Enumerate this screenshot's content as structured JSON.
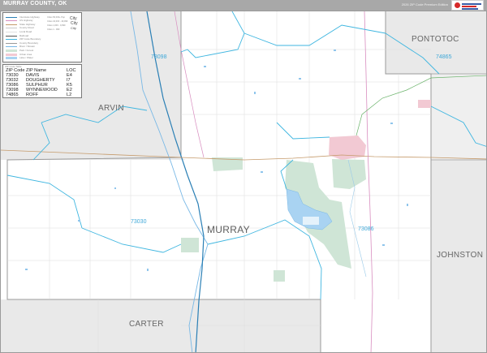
{
  "title": "MURRAY COUNTY, OK",
  "edition": "2026 ZIP Code Premium Edition",
  "colors": {
    "neighbor_county": "#e9e9e9",
    "county_line": "#9a9a9a",
    "zip_line": "#3fb6e0",
    "interstate": "#2a7fb5",
    "highway": "#c59a6a",
    "us_route": "#d88dbf",
    "park": "#cfe5d6",
    "urban": "#f2c9d3",
    "water": "#78b8e6",
    "road": "#d6d6d6"
  },
  "legend": {
    "items": [
      {
        "label": "Interstate Highway",
        "color": "#2a7fb5",
        "icon": "interstate-line"
      },
      {
        "label": "US Highway",
        "color": "#d88dbf",
        "icon": "us-highway-line"
      },
      {
        "label": "State Highway",
        "color": "#c59a6a",
        "icon": "state-highway-line"
      },
      {
        "label": "County Road",
        "color": "#c8c8c8",
        "icon": "county-road-line"
      },
      {
        "label": "Local Road",
        "color": "#e0e0e0",
        "icon": "local-road-line"
      },
      {
        "label": "Railroad",
        "color": "#555555",
        "icon": "railroad-line"
      },
      {
        "label": "ZIP Code Boundary",
        "color": "#3fb6e0",
        "icon": "zip-boundary-line"
      },
      {
        "label": "County Boundary",
        "color": "#9a9a9a",
        "icon": "county-boundary-line"
      },
      {
        "label": "River / Stream",
        "color": "#78b8e6",
        "icon": "river-line"
      },
      {
        "label": "Park / Forest",
        "color": "#cfe5d6",
        "icon": "park-swatch"
      },
      {
        "label": "Urban Area",
        "color": "#f2c9d3",
        "icon": "urban-swatch"
      },
      {
        "label": "Lake / Water",
        "color": "#a9d3f2",
        "icon": "water-swatch"
      }
    ],
    "city_key": [
      {
        "label": "City",
        "icon": "city-large"
      },
      {
        "label": "City",
        "icon": "city-medium"
      },
      {
        "label": "City",
        "icon": "city-small"
      }
    ],
    "population_rows": [
      "Cities 50,000+ Pop",
      "Cities 10,000 - 49,999",
      "Cities 1,000 - 9,999",
      "Cities 1 - 999"
    ]
  },
  "zip_table": {
    "title": "ZIP Code Table",
    "headers": [
      "ZIP Code",
      "ZIP Name",
      "LOC"
    ],
    "rows": [
      [
        "73030",
        "DAVIS",
        "E4"
      ],
      [
        "73032",
        "DOUGHERTY",
        "I7"
      ],
      [
        "73086",
        "SULPHUR",
        "K5"
      ],
      [
        "73098",
        "WYNNEWOOD",
        "E2"
      ],
      [
        "74865",
        "ROFF",
        "L2"
      ]
    ]
  },
  "labels": {
    "counties": {
      "pontotoc": "PONTOTOC",
      "garvin": "ARVIN",
      "murray": "MURRAY",
      "johnston": "JOHNSTON",
      "carter": "CARTER"
    },
    "zips": {
      "z73098": "73098",
      "z74865": "74865",
      "z73030": "73030",
      "z73086": "73086"
    }
  }
}
